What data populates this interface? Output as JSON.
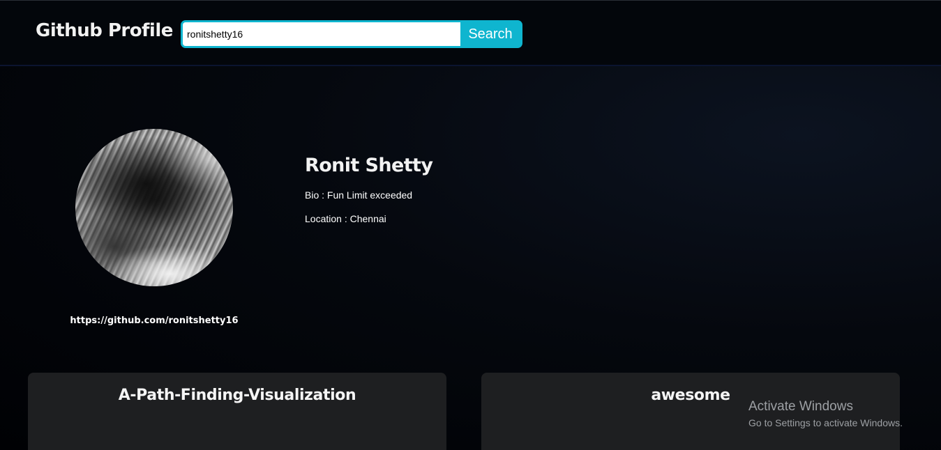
{
  "header": {
    "brand": "Github Profile",
    "search_value": "ronitshetty16",
    "search_button": "Search"
  },
  "profile": {
    "name": "Ronit Shetty",
    "bio": "Bio : Fun Limit exceeded",
    "location": "Location : Chennai",
    "url": "https://github.com/ronitshetty16"
  },
  "repos": [
    {
      "name": "A-Path-Finding-Visualization"
    },
    {
      "name": "awesome"
    }
  ],
  "watermark": {
    "title": "Activate Windows",
    "subtitle": "Go to Settings to activate Windows."
  },
  "colors": {
    "accent": "#0fb5cf",
    "card": "#1e1f21",
    "background": "#000104"
  }
}
